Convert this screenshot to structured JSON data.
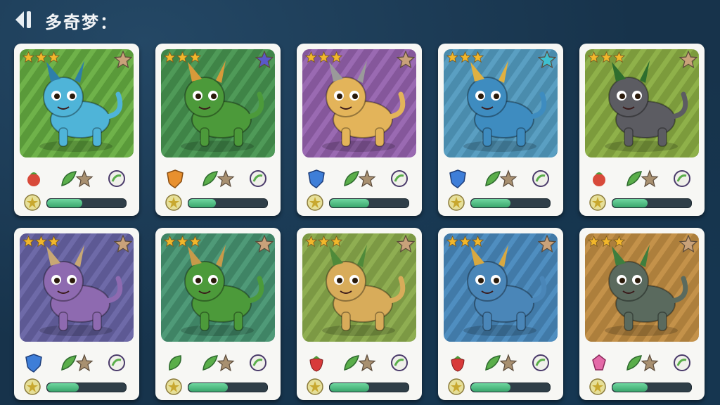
{
  "header": {
    "title": "多奇梦："
  },
  "cards": [
    {
      "name": "blue-cat-creature",
      "bg": "#6fb24a",
      "bg2": "#5a9a3a",
      "body": "#4fb4d8",
      "accent": "#2e7fa8",
      "stars": 3,
      "rarity": "bronze",
      "element": "fire-fruit",
      "progress": 0.45
    },
    {
      "name": "green-dragon",
      "bg": "#4f9a58",
      "bg2": "#3f8447",
      "body": "#4c9a3a",
      "accent": "#d79a3a",
      "stars": 3,
      "rarity": "purple",
      "element": "orange-shield",
      "progress": 0.35
    },
    {
      "name": "golden-ram-creature",
      "bg": "#9a6ab2",
      "bg2": "#85579b",
      "body": "#e3b45a",
      "accent": "#9a9a9a",
      "stars": 3,
      "rarity": "none",
      "element": "blue-shield",
      "progress": 0.5
    },
    {
      "name": "blue-winged-dragon",
      "bg": "#5a9fc2",
      "bg2": "#4a8cad",
      "body": "#3e8cc0",
      "accent": "#e0b040",
      "stars": 3,
      "rarity": "teal",
      "element": "blue-shield",
      "progress": 0.5
    },
    {
      "name": "grey-rock-beast",
      "bg": "#8fb14a",
      "bg2": "#7c9b3c",
      "body": "#5c5c62",
      "accent": "#2e6e2e",
      "stars": 3,
      "rarity": "bronze",
      "element": "fire-fruit",
      "progress": 0.45
    },
    {
      "name": "purple-horned-creature",
      "bg": "#6e6aa8",
      "bg2": "#5d5994",
      "body": "#8e6ab0",
      "accent": "#c8a874",
      "stars": 3,
      "rarity": "none",
      "element": "blue-shield",
      "progress": 0.4
    },
    {
      "name": "green-horned-dragon",
      "bg": "#4f9a78",
      "bg2": "#3f8465",
      "body": "#4c9a3a",
      "accent": "#c89a4a",
      "stars": 3,
      "rarity": "none",
      "element": "green-leaf",
      "progress": 0.5
    },
    {
      "name": "golden-winged-dragon",
      "bg": "#8fae52",
      "bg2": "#7c9944",
      "body": "#d8ac5a",
      "accent": "#4f8a3a",
      "stars": 3,
      "rarity": "none",
      "element": "strawberry",
      "progress": 0.5
    },
    {
      "name": "blue-horned-dragon",
      "bg": "#4f8ec0",
      "bg2": "#417aa8",
      "body": "#4a86b8",
      "accent": "#d8a840",
      "stars": 3,
      "rarity": "none",
      "element": "strawberry",
      "progress": 0.5
    },
    {
      "name": "green-shell-beast",
      "bg": "#c4924a",
      "bg2": "#ad7f3c",
      "body": "#5a6a5e",
      "accent": "#3e7e3e",
      "stars": 3,
      "rarity": "none",
      "element": "pink-gem",
      "progress": 0.45
    }
  ],
  "colors": {
    "star_gold": "#f2b72b",
    "star_empty": "#b8a088",
    "bar_fill": "#4fbe80",
    "bar_bg": "#2f3e48",
    "card_bg": "#f7f7f4"
  }
}
